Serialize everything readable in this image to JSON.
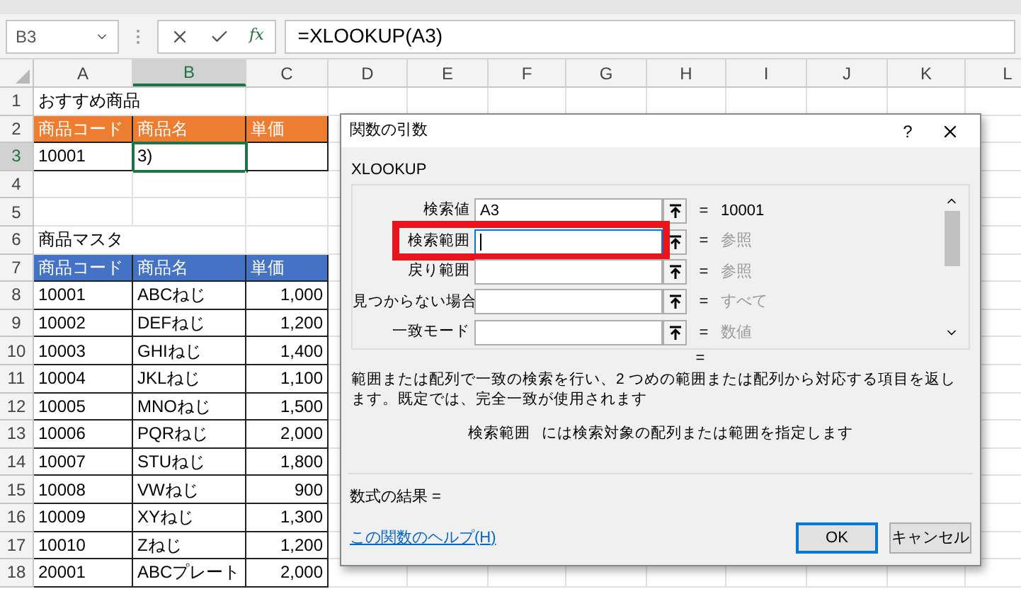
{
  "formula_bar": {
    "name_box": "B3",
    "function_button": "fx",
    "formula": "=XLOOKUP(A3)"
  },
  "columns": [
    {
      "label": "A",
      "selected": false
    },
    {
      "label": "B",
      "selected": true
    },
    {
      "label": "C",
      "selected": false
    },
    {
      "label": "D",
      "selected": false
    },
    {
      "label": "E",
      "selected": false
    },
    {
      "label": "F",
      "selected": false
    },
    {
      "label": "G",
      "selected": false
    },
    {
      "label": "H",
      "selected": false
    },
    {
      "label": "I",
      "selected": false
    },
    {
      "label": "J",
      "selected": false
    },
    {
      "label": "K",
      "selected": false
    },
    {
      "label": "L",
      "selected": false
    }
  ],
  "rows": [
    {
      "number": "1",
      "selected": false,
      "kind": "title",
      "cells": {
        "A": "おすすめ商品"
      }
    },
    {
      "number": "2",
      "selected": false,
      "kind": "header",
      "color": "#ed7d31",
      "cells": {
        "A": "商品コード",
        "B": "商品名",
        "C": "単価"
      }
    },
    {
      "number": "3",
      "selected": true,
      "kind": "data",
      "cells": {
        "A": "10001",
        "B": "3)"
      }
    },
    {
      "number": "4",
      "selected": false,
      "kind": "blank",
      "cells": {}
    },
    {
      "number": "5",
      "selected": false,
      "kind": "blank",
      "cells": {}
    },
    {
      "number": "6",
      "selected": false,
      "kind": "title",
      "cells": {
        "A": "商品マスタ"
      }
    },
    {
      "number": "7",
      "selected": false,
      "kind": "header",
      "color": "#4472c4",
      "cells": {
        "A": "商品コード",
        "B": "商品名",
        "C": "単価"
      }
    },
    {
      "number": "8",
      "selected": false,
      "kind": "data",
      "cells": {
        "A": "10001",
        "B": "ABCねじ",
        "C": "1,000"
      }
    },
    {
      "number": "9",
      "selected": false,
      "kind": "data",
      "cells": {
        "A": "10002",
        "B": "DEFねじ",
        "C": "1,200"
      }
    },
    {
      "number": "10",
      "selected": false,
      "kind": "data",
      "cells": {
        "A": "10003",
        "B": "GHIねじ",
        "C": "1,400"
      }
    },
    {
      "number": "11",
      "selected": false,
      "kind": "data",
      "cells": {
        "A": "10004",
        "B": "JKLねじ",
        "C": "1,100"
      }
    },
    {
      "number": "12",
      "selected": false,
      "kind": "data",
      "cells": {
        "A": "10005",
        "B": "MNOねじ",
        "C": "1,500"
      }
    },
    {
      "number": "13",
      "selected": false,
      "kind": "data",
      "cells": {
        "A": "10006",
        "B": "PQRねじ",
        "C": "2,000"
      }
    },
    {
      "number": "14",
      "selected": false,
      "kind": "data",
      "cells": {
        "A": "10007",
        "B": "STUねじ",
        "C": "1,800"
      }
    },
    {
      "number": "15",
      "selected": false,
      "kind": "data",
      "cells": {
        "A": "10008",
        "B": "VWねじ",
        "C": "900"
      }
    },
    {
      "number": "16",
      "selected": false,
      "kind": "data",
      "cells": {
        "A": "10009",
        "B": "XYねじ",
        "C": "1,300"
      }
    },
    {
      "number": "17",
      "selected": false,
      "kind": "data",
      "cells": {
        "A": "10010",
        "B": "Zねじ",
        "C": "1,200"
      }
    },
    {
      "number": "18",
      "selected": false,
      "kind": "data",
      "cells": {
        "A": "20001",
        "B": "ABCプレート",
        "C": "2,000"
      }
    }
  ],
  "dialog": {
    "title": "関数の引数",
    "help": "?",
    "function_name": "XLOOKUP",
    "args": [
      {
        "label": "検索値",
        "value": "A3",
        "equals": "=",
        "result": "10001",
        "evaluated": true,
        "focused": false,
        "highlighted": false
      },
      {
        "label": "検索範囲",
        "equals": "=",
        "result": "参照",
        "evaluated": false,
        "focused": true,
        "highlighted": true
      },
      {
        "label": "戻り範囲",
        "equals": "=",
        "result": "参照",
        "evaluated": false,
        "focused": false,
        "highlighted": false
      },
      {
        "label": "見つからない場合",
        "equals": "=",
        "result": "すべて",
        "evaluated": false,
        "focused": false,
        "highlighted": false
      },
      {
        "label": "一致モード",
        "equals": "=",
        "result": "数値",
        "evaluated": false,
        "focused": false,
        "highlighted": false
      }
    ],
    "overall_equals": "=",
    "description": "範囲または配列で一致の検索を行い、2 つめの範囲または配列から対応する項目を返します。既定では、完全一致が使用されます",
    "arg_help": {
      "name": "検索範囲",
      "text": "には検索対象の配列または範囲を指定します"
    },
    "formula_result": "数式の結果 =",
    "help_link": "この関数のヘルプ(H)",
    "buttons": [
      {
        "label": "OK",
        "default": true
      },
      {
        "label": "キャンセル",
        "default": false
      }
    ]
  }
}
